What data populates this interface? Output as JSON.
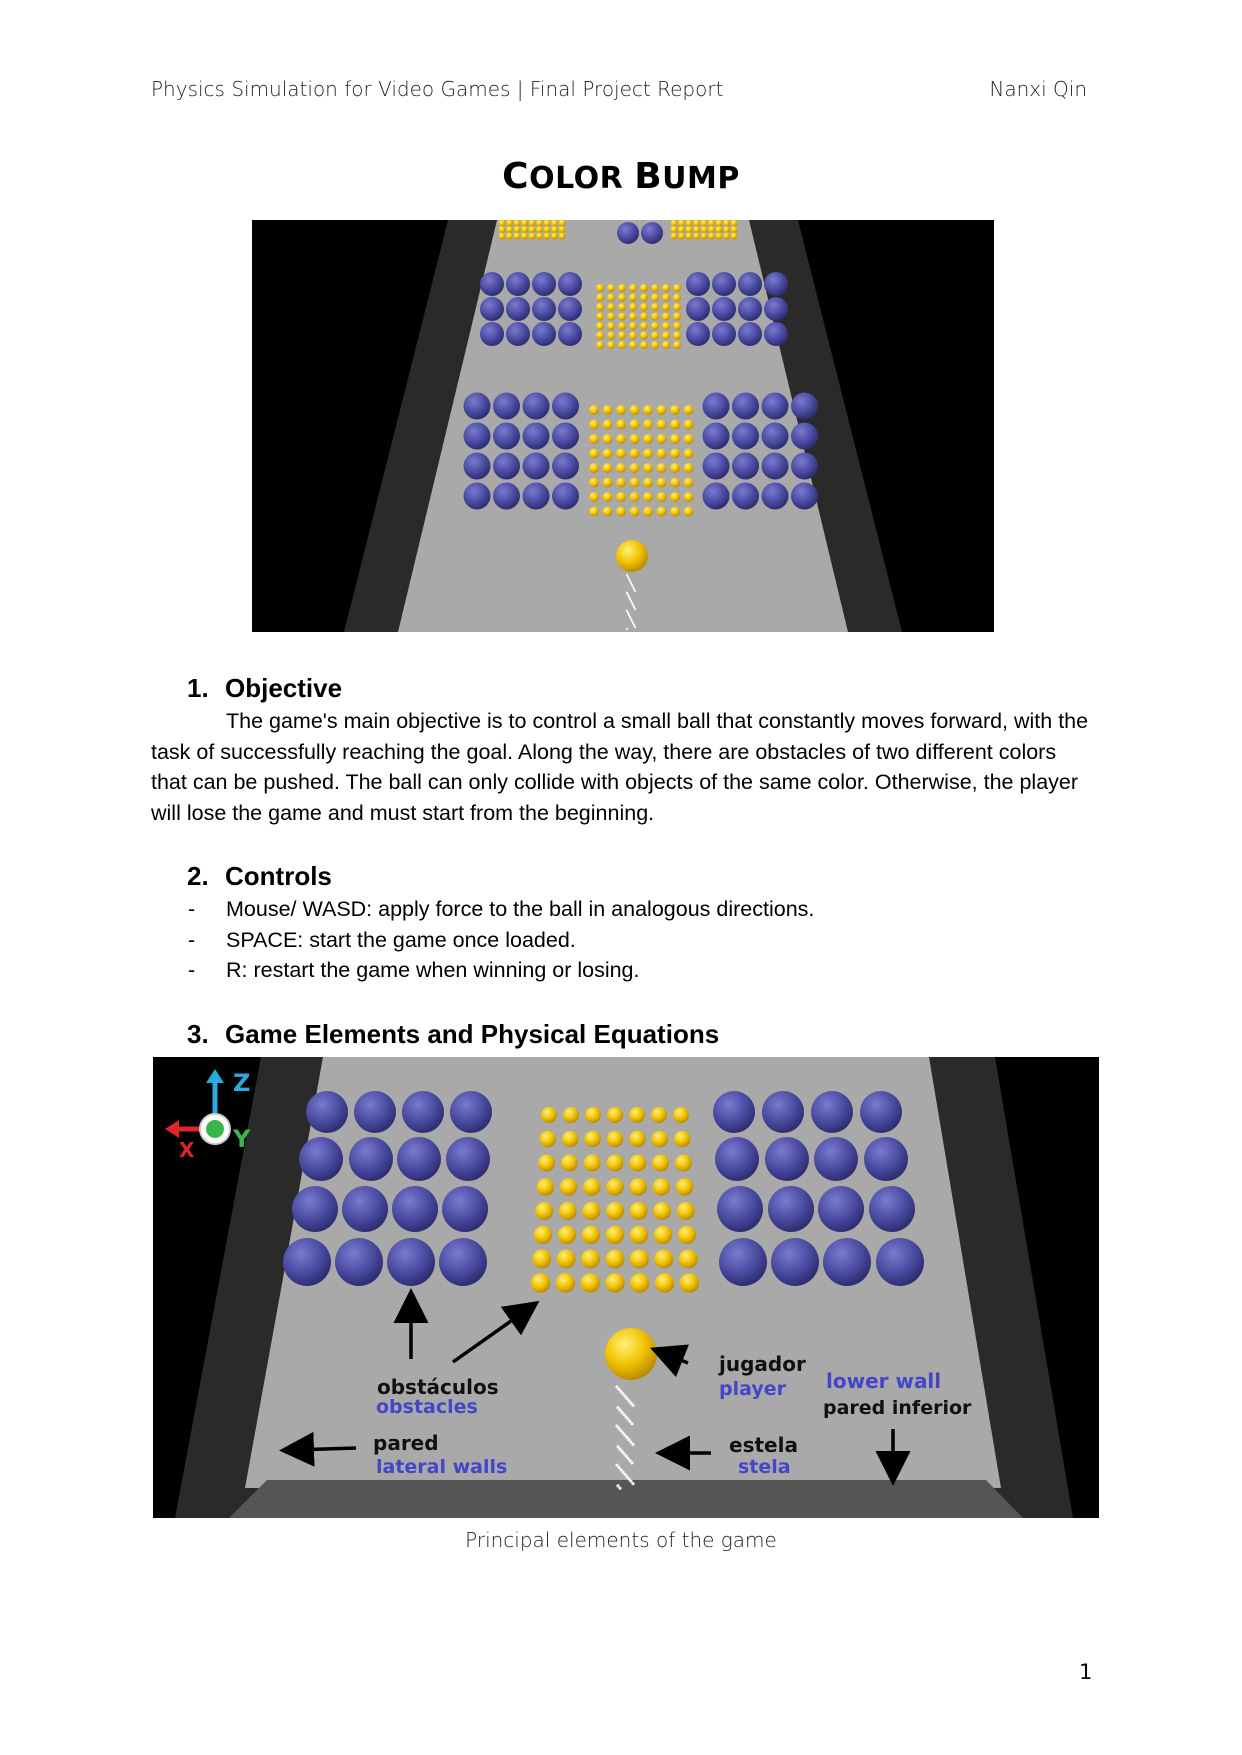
{
  "header": {
    "left": "Physics Simulation for Video Games | Final Project Report",
    "right": "Nanxi Qin"
  },
  "title": {
    "c1": "C",
    "r1": "OLOR ",
    "c2": "B",
    "r2": "UMP"
  },
  "colors": {
    "blue_ball": "#4a4aa0",
    "yellow_ball": "#f2c200",
    "floor": "#a9a9a9",
    "wall": "#2a2a2a"
  },
  "sections": [
    {
      "num": "1.",
      "heading": "Objective",
      "text": "The game's main objective is to control a small ball that constantly moves forward, with the task of successfully reaching the goal. Along the way, there are obstacles of two different colors that can be pushed. The ball can only collide with objects of the same color. Otherwise, the player will lose the game and must start from the beginning."
    },
    {
      "num": "2.",
      "heading": "Controls",
      "dash": "-",
      "items": [
        "Mouse/ WASD: apply force to the ball in analogous directions.",
        "SPACE: start the game once loaded.",
        "R: restart the game when winning or losing."
      ]
    },
    {
      "num": "3.",
      "heading": "Game Elements and Physical Equations"
    }
  ],
  "figure2": {
    "axes": {
      "z": "Z",
      "x": "X",
      "y": "Y"
    },
    "labels": {
      "obstacles_es": "obstáculos",
      "obstacles_en": "obstacles",
      "player_es": "jugador",
      "player_en": "player",
      "lower_wall_en": "lower wall",
      "lower_wall_es": "pared inferior",
      "walls_es": "pared",
      "walls_en": "lateral walls",
      "trail_es": "estela",
      "trail_en": "stela"
    },
    "caption": "Principal elements of the game"
  },
  "page_number": "1"
}
